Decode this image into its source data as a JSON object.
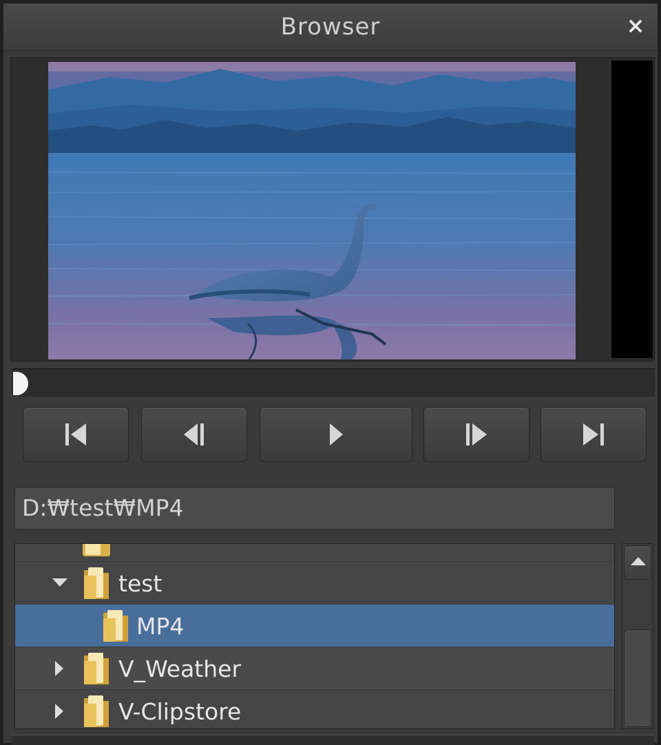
{
  "window": {
    "title": "Browser",
    "close_label": "×"
  },
  "transport": {
    "buttons": [
      "go-to-start",
      "step-back",
      "play",
      "step-forward",
      "go-to-end"
    ]
  },
  "path": {
    "value": "D:₩test₩MP4"
  },
  "tree": {
    "items": [
      {
        "label": "test",
        "expanded": true,
        "selected": false
      },
      {
        "label": "MP4",
        "expanded": false,
        "selected": true
      },
      {
        "label": "V_Weather",
        "expanded": false,
        "selected": false
      },
      {
        "label": "V-Clipstore",
        "expanded": false,
        "selected": false
      }
    ]
  },
  "colors": {
    "selection": "#4a6e9c",
    "panel": "#3a3a3a"
  }
}
